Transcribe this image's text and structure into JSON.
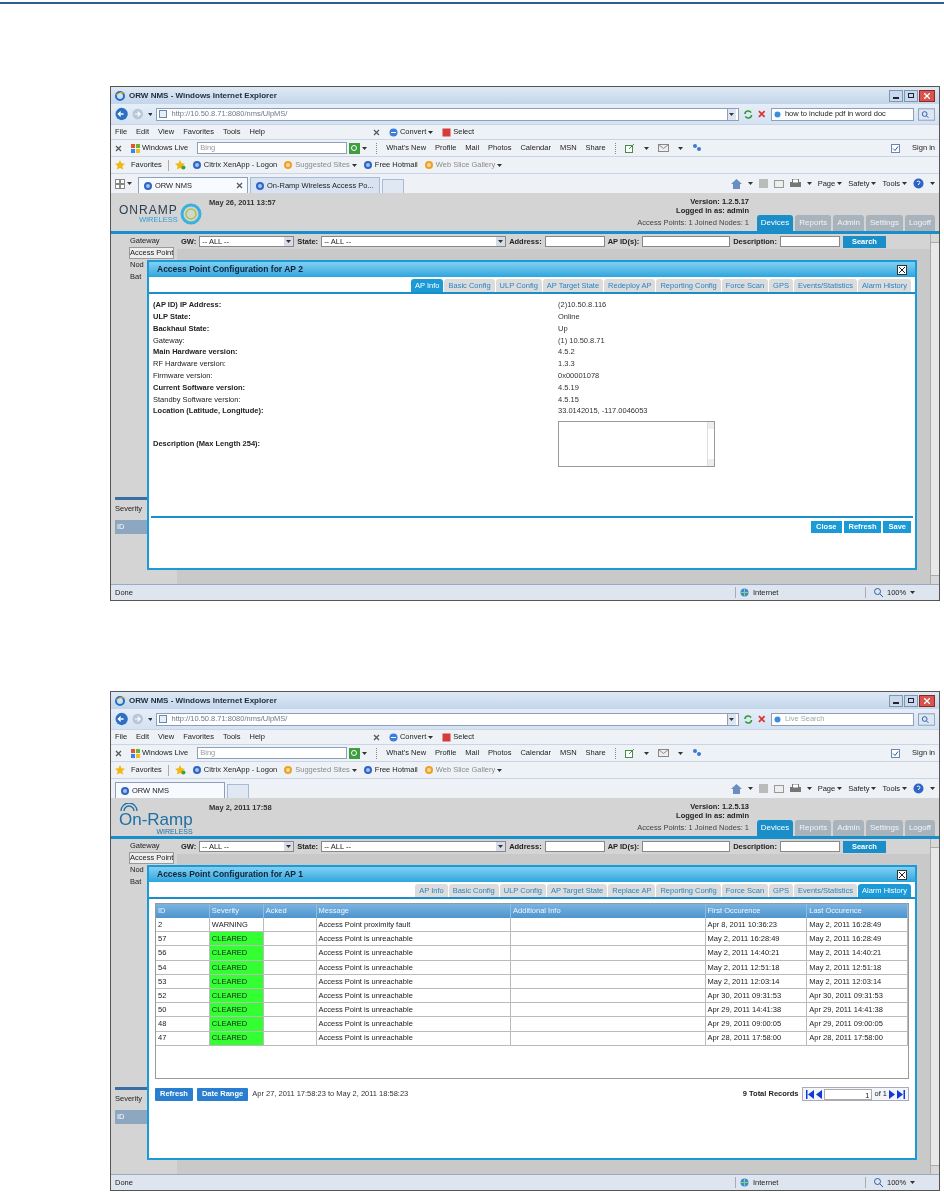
{
  "screenshots": [
    {
      "browser": {
        "title": "ORW NMS - Windows Internet Explorer",
        "url": "http://10.50.8.71:8080/nms/UlpMS/",
        "search": {
          "value": "how to include pdf in word doc"
        },
        "menu": [
          "File",
          "Edit",
          "View",
          "Favorites",
          "Tools",
          "Help"
        ],
        "convert": "Convert",
        "select": "Select",
        "live_label": "Windows Live",
        "live_search": {
          "placeholder": "Bing"
        },
        "live_items": [
          "What's New",
          "Profile",
          "Mail",
          "Photos",
          "Calendar",
          "MSN",
          "Share"
        ],
        "sign_in": "Sign in",
        "favorites_label": "Favorites",
        "favorites": [
          {
            "label": "Citrix XenApp - Logon",
            "dim": false,
            "menu": false
          },
          {
            "label": "Suggested Sites",
            "dim": true,
            "menu": true
          },
          {
            "label": "Free Hotmail",
            "dim": false,
            "menu": false
          },
          {
            "label": "Web Slice Gallery",
            "dim": true,
            "menu": true
          }
        ],
        "tabs": [
          {
            "label": "ORW NMS",
            "selected": true
          },
          {
            "label": "On-Ramp Wireless Access Po...",
            "selected": false
          }
        ],
        "commands": [
          "Page",
          "Safety",
          "Tools"
        ],
        "status": "Done",
        "zone": "Internet",
        "zoom": "100%"
      },
      "app": {
        "logo": {
          "kind": "ring",
          "text": "ONRAMP",
          "subtext": "WIRELESS"
        },
        "date": "May 26, 2011 13:57",
        "version": "Version: 1.2.5.17",
        "user": "Logged in as: admin",
        "counts": "Access Points: 1 Joined Nodes: 1",
        "nav": [
          {
            "label": "Devices",
            "selected": true
          },
          {
            "label": "Reports",
            "selected": false
          },
          {
            "label": "Admin",
            "selected": false
          },
          {
            "label": "Settings",
            "selected": false
          },
          {
            "label": "Logoff",
            "selected": false
          }
        ],
        "sidebar": [
          {
            "label": "Gateway",
            "selected": false
          },
          {
            "label": "Access Point",
            "selected": true
          },
          {
            "label": "Nod",
            "selected": false
          },
          {
            "label": "Bat",
            "selected": false
          }
        ],
        "filters": {
          "gw_label": "GW:",
          "gw": "-- ALL --",
          "state_label": "State:",
          "state": "-- ALL --",
          "address_label": "Address:",
          "apid_label": "AP ID(s):",
          "description_label": "Description:",
          "search": "Search"
        },
        "lower_pane": {
          "heading": "Severity",
          "column": "ID"
        }
      },
      "dialog": {
        "title": "Access Point Configuration for AP 2",
        "tabs": [
          {
            "label": "AP Info",
            "selected": true
          },
          {
            "label": "Basic Config",
            "selected": false
          },
          {
            "label": "ULP Config",
            "selected": false
          },
          {
            "label": "AP Target State",
            "selected": false
          },
          {
            "label": "Redeploy AP",
            "selected": false
          },
          {
            "label": "Reporting Config",
            "selected": false
          },
          {
            "label": "Force Scan",
            "selected": false
          },
          {
            "label": "GPS",
            "selected": false
          },
          {
            "label": "Events/Statistics",
            "selected": false
          },
          {
            "label": "Alarm History",
            "selected": false
          }
        ],
        "content": {
          "kind": "info",
          "fields": [
            {
              "kind": "text",
              "label": "(AP ID) IP Address:",
              "bold": true,
              "value": "(2)10.50.8.116"
            },
            {
              "kind": "text",
              "label": "ULP State:",
              "bold": true,
              "value": "Online"
            },
            {
              "kind": "text",
              "label": "Backhaul State:",
              "bold": true,
              "value": "Up"
            },
            {
              "kind": "text",
              "label": "Gateway:",
              "bold": false,
              "value": "(1) 10.50.8.71"
            },
            {
              "kind": "text",
              "label": "Main Hardware version:",
              "bold": true,
              "value": "4.5.2"
            },
            {
              "kind": "text",
              "label": "RF Hardware version:",
              "bold": false,
              "value": "1.3.3"
            },
            {
              "kind": "text",
              "label": "Firmware version:",
              "bold": false,
              "value": "0x00001078"
            },
            {
              "kind": "text",
              "label": "Current Software version:",
              "bold": true,
              "value": "4.5.19"
            },
            {
              "kind": "text",
              "label": "Standby Software version:",
              "bold": false,
              "value": "4.5.15"
            },
            {
              "kind": "text",
              "label": "Location (Latitude, Longitude):",
              "bold": true,
              "value": "33.0142015, -117.0046053"
            },
            {
              "kind": "textarea",
              "label": "Description (Max Length 254):",
              "bold": true
            }
          ],
          "buttons": [
            "Close",
            "Refresh",
            "Save"
          ]
        }
      }
    },
    {
      "browser": {
        "title": "ORW NMS - Windows Internet Explorer",
        "url": "http://10.50.8.71:8080/nms/UlpMS/",
        "search": {
          "placeholder": "Live Search"
        },
        "menu": [
          "File",
          "Edit",
          "View",
          "Favorites",
          "Tools",
          "Help"
        ],
        "convert": "Convert",
        "select": "Select",
        "live_label": "Windows Live",
        "live_search": {
          "placeholder": "Bing"
        },
        "live_items": [
          "What's New",
          "Profile",
          "Mail",
          "Photos",
          "Calendar",
          "MSN",
          "Share"
        ],
        "sign_in": "Sign in",
        "favorites_label": "Favorites",
        "favorites": [
          {
            "label": "Citrix XenApp - Logon",
            "dim": false,
            "menu": false
          },
          {
            "label": "Suggested Sites",
            "dim": true,
            "menu": true
          },
          {
            "label": "Free Hotmail",
            "dim": false,
            "menu": false
          },
          {
            "label": "Web Slice Gallery",
            "dim": true,
            "menu": true
          }
        ],
        "tabs": [
          {
            "label": "ORW NMS",
            "selected": true
          }
        ],
        "commands": [
          "Page",
          "Safety",
          "Tools"
        ],
        "status": "Done",
        "zone": "Internet",
        "zoom": "100%"
      },
      "app": {
        "logo": {
          "kind": "wave",
          "text": "On-Ramp",
          "subtext": "WIRELESS"
        },
        "date": "May 2, 2011 17:58",
        "version": "Version: 1.2.5.13",
        "user": "Logged in as: admin",
        "counts": "Access Points: 1 Joined Nodes: 1",
        "nav": [
          {
            "label": "Devices",
            "selected": true
          },
          {
            "label": "Reports",
            "selected": false
          },
          {
            "label": "Admin",
            "selected": false
          },
          {
            "label": "Settings",
            "selected": false
          },
          {
            "label": "Logoff",
            "selected": false
          }
        ],
        "sidebar": [
          {
            "label": "Gateway",
            "selected": false
          },
          {
            "label": "Access Point",
            "selected": true
          },
          {
            "label": "Nod",
            "selected": false
          },
          {
            "label": "Bat",
            "selected": false
          }
        ],
        "filters": {
          "gw_label": "GW:",
          "gw": "-- ALL --",
          "state_label": "State:",
          "state": "-- ALL --",
          "address_label": "Address:",
          "apid_label": "AP ID(s):",
          "description_label": "Description:",
          "search": "Search"
        },
        "lower_pane": {
          "heading": "Severity",
          "column": "ID"
        }
      },
      "dialog": {
        "title": "Access Point Configuration for AP 1",
        "tabs": [
          {
            "label": "AP Info",
            "selected": false
          },
          {
            "label": "Basic Config",
            "selected": false
          },
          {
            "label": "ULP Config",
            "selected": false
          },
          {
            "label": "AP Target State",
            "selected": false
          },
          {
            "label": "Replace AP",
            "selected": false
          },
          {
            "label": "Reporting Config",
            "selected": false
          },
          {
            "label": "Force Scan",
            "selected": false
          },
          {
            "label": "GPS",
            "selected": false
          },
          {
            "label": "Events/Statistics",
            "selected": false
          },
          {
            "label": "Alarm History",
            "selected": true
          }
        ],
        "content": {
          "kind": "alarms",
          "columns": [
            "ID",
            "Severity",
            "Acked",
            "Message",
            "Additional Info",
            "First Occurence",
            "Last Occurence"
          ],
          "rows": [
            {
              "id": "2",
              "severity": "WARNING",
              "message": "Access Point proximity fault",
              "first": "Apr 8, 2011 10:36:23",
              "last": "May 2, 2011 16:28:49"
            },
            {
              "id": "57",
              "severity": "CLEARED",
              "color": "#33ff33",
              "message": "Access Point is unreachable",
              "first": "May 2, 2011 16:28:49",
              "last": "May 2, 2011 16:28:49"
            },
            {
              "id": "56",
              "severity": "CLEARED",
              "color": "#33ff33",
              "message": "Access Point is unreachable",
              "first": "May 2, 2011 14:40:21",
              "last": "May 2, 2011 14:40:21"
            },
            {
              "id": "54",
              "severity": "CLEARED",
              "color": "#33ff33",
              "message": "Access Point is unreachable",
              "first": "May 2, 2011 12:51:18",
              "last": "May 2, 2011 12:51:18"
            },
            {
              "id": "53",
              "severity": "CLEARED",
              "color": "#33ff33",
              "message": "Access Point is unreachable",
              "first": "May 2, 2011 12:03:14",
              "last": "May 2, 2011 12:03:14"
            },
            {
              "id": "52",
              "severity": "CLEARED",
              "color": "#33ff33",
              "message": "Access Point is unreachable",
              "first": "Apr 30, 2011 09:31:53",
              "last": "Apr 30, 2011 09:31:53"
            },
            {
              "id": "50",
              "severity": "CLEARED",
              "color": "#33ff33",
              "message": "Access Point is unreachable",
              "first": "Apr 29, 2011 14:41:38",
              "last": "Apr 29, 2011 14:41:38"
            },
            {
              "id": "48",
              "severity": "CLEARED",
              "color": "#33ff33",
              "message": "Access Point is unreachable",
              "first": "Apr 29, 2011 09:00:05",
              "last": "Apr 29, 2011 09:00:05"
            },
            {
              "id": "47",
              "severity": "CLEARED",
              "color": "#33ff33",
              "message": "Access Point is unreachable",
              "first": "Apr 28, 2011 17:58:00",
              "last": "Apr 28, 2011 17:58:00"
            }
          ],
          "footer": {
            "buttons": [
              "Refresh",
              "Date Range"
            ],
            "range": "Apr 27, 2011 17:58:23 to May 2, 2011 18:58:23",
            "total": "9 Total Records",
            "page": "1",
            "of": "of 1"
          }
        }
      }
    }
  ]
}
